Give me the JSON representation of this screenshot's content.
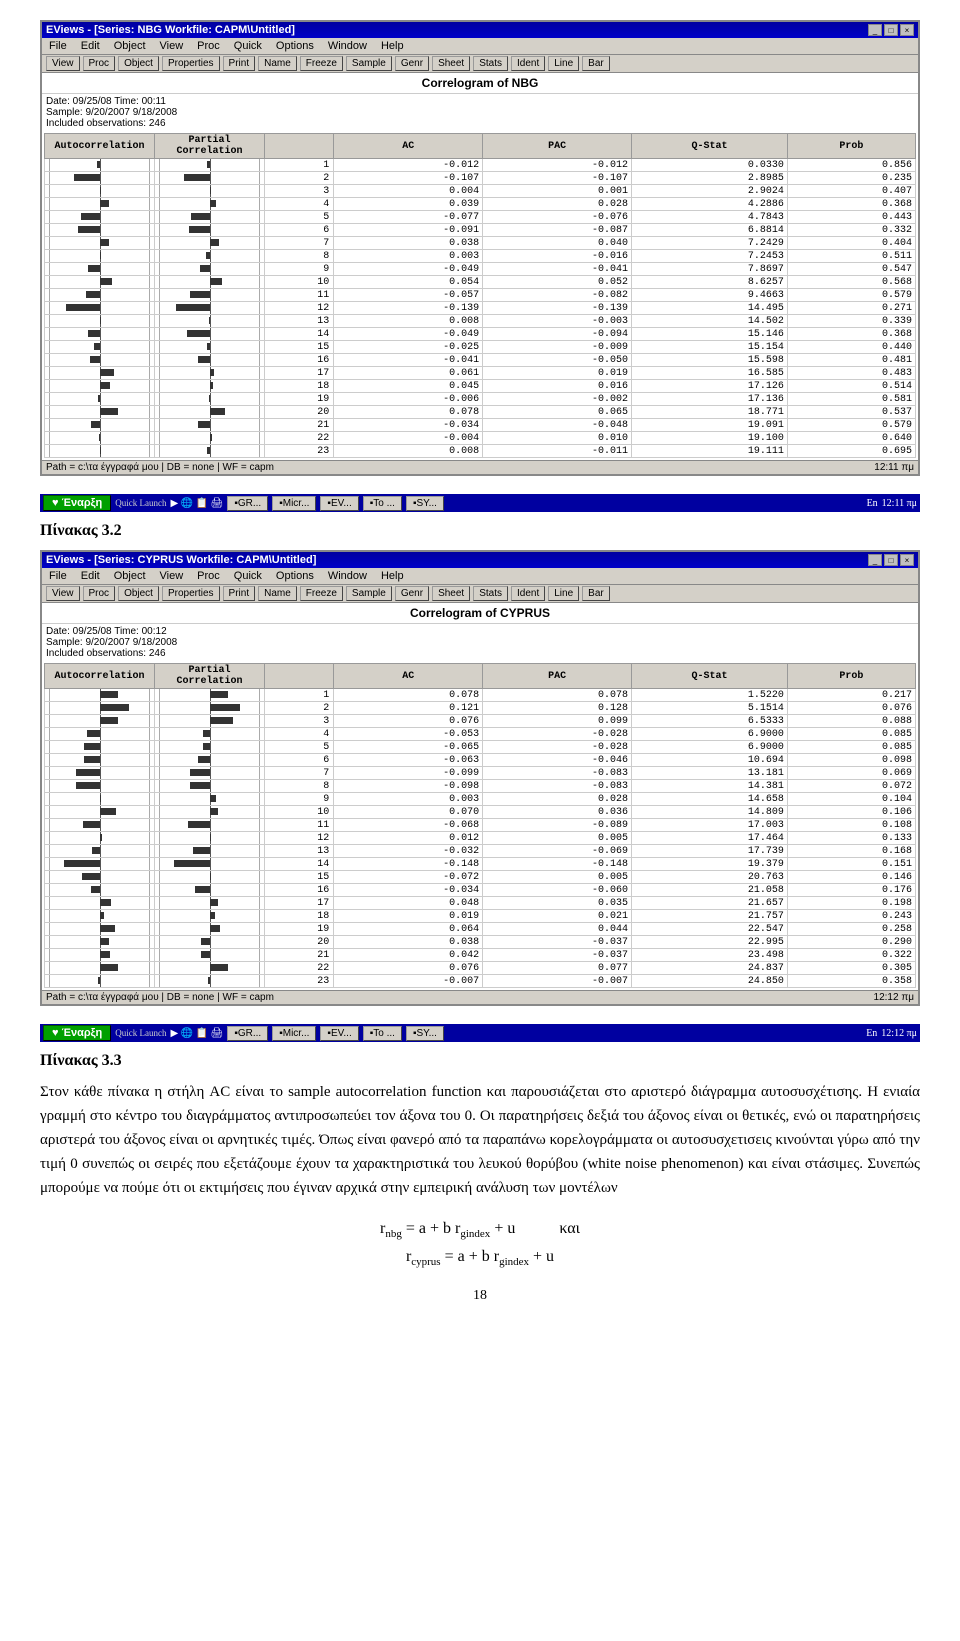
{
  "page": {
    "section1_label": "Πίνακας 3.2",
    "section2_label": "Πίνακας 3.3",
    "page_number": "18"
  },
  "window1": {
    "title": "EViews - [Series: NBG  Workfile: CAPM\\Untitled]",
    "menu_items": [
      "File",
      "Edit",
      "Object",
      "View",
      "Proc",
      "Quick",
      "Options",
      "Window",
      "Help"
    ],
    "toolbar_items": [
      "View",
      "Proc",
      "Object",
      "Properties",
      "Print",
      "Name",
      "Freeze",
      "Sample",
      "Genr",
      "Sheet",
      "Stats",
      "Ident",
      "Line",
      "Bar"
    ],
    "inner_title": "Correlogram of NBG",
    "info_line1": "Date: 09/25/08  Time: 00:11",
    "info_line2": "Sample: 9/20/2007 9/18/2008",
    "info_line3": "Included observations: 246",
    "columns": [
      "Autocorrelation",
      "Partial Correlation",
      "",
      "AC",
      "PAC",
      "Q-Stat",
      "Prob"
    ],
    "rows": [
      {
        "lag": "1",
        "ac": "-0.012",
        "pac": "-0.012",
        "qstat": "0.0330",
        "prob": "0.856"
      },
      {
        "lag": "2",
        "ac": "-0.107",
        "pac": "-0.107",
        "qstat": "2.8985",
        "prob": "0.235"
      },
      {
        "lag": "3",
        "ac": "0.004",
        "pac": "0.001",
        "qstat": "2.9024",
        "prob": "0.407"
      },
      {
        "lag": "4",
        "ac": "0.039",
        "pac": "0.028",
        "qstat": "4.2886",
        "prob": "0.368"
      },
      {
        "lag": "5",
        "ac": "-0.077",
        "pac": "-0.076",
        "qstat": "4.7843",
        "prob": "0.443"
      },
      {
        "lag": "6",
        "ac": "-0.091",
        "pac": "-0.087",
        "qstat": "6.8814",
        "prob": "0.332"
      },
      {
        "lag": "7",
        "ac": "0.038",
        "pac": "0.040",
        "qstat": "7.2429",
        "prob": "0.404"
      },
      {
        "lag": "8",
        "ac": "0.003",
        "pac": "-0.016",
        "qstat": "7.2453",
        "prob": "0.511"
      },
      {
        "lag": "9",
        "ac": "-0.049",
        "pac": "-0.041",
        "qstat": "7.8697",
        "prob": "0.547"
      },
      {
        "lag": "10",
        "ac": "0.054",
        "pac": "0.052",
        "qstat": "8.6257",
        "prob": "0.568"
      },
      {
        "lag": "11",
        "ac": "-0.057",
        "pac": "-0.082",
        "qstat": "9.4663",
        "prob": "0.579"
      },
      {
        "lag": "12",
        "ac": "-0.139",
        "pac": "-0.139",
        "qstat": "14.495",
        "prob": "0.271"
      },
      {
        "lag": "13",
        "ac": "0.008",
        "pac": "-0.003",
        "qstat": "14.502",
        "prob": "0.339"
      },
      {
        "lag": "14",
        "ac": "-0.049",
        "pac": "-0.094",
        "qstat": "15.146",
        "prob": "0.368"
      },
      {
        "lag": "15",
        "ac": "-0.025",
        "pac": "-0.009",
        "qstat": "15.154",
        "prob": "0.440"
      },
      {
        "lag": "16",
        "ac": "-0.041",
        "pac": "-0.050",
        "qstat": "15.598",
        "prob": "0.481"
      },
      {
        "lag": "17",
        "ac": "0.061",
        "pac": "0.019",
        "qstat": "16.585",
        "prob": "0.483"
      },
      {
        "lag": "18",
        "ac": "0.045",
        "pac": "0.016",
        "qstat": "17.126",
        "prob": "0.514"
      },
      {
        "lag": "19",
        "ac": "-0.006",
        "pac": "-0.002",
        "qstat": "17.136",
        "prob": "0.581"
      },
      {
        "lag": "20",
        "ac": "0.078",
        "pac": "0.065",
        "qstat": "18.771",
        "prob": "0.537"
      },
      {
        "lag": "21",
        "ac": "-0.034",
        "pac": "-0.048",
        "qstat": "19.091",
        "prob": "0.579"
      },
      {
        "lag": "22",
        "ac": "-0.004",
        "pac": "0.010",
        "qstat": "19.100",
        "prob": "0.640"
      },
      {
        "lag": "23",
        "ac": "0.008",
        "pac": "-0.011",
        "qstat": "19.111",
        "prob": "0.695"
      }
    ],
    "statusbar": "Path = c:\\τα έγγραφά μου | DB = none | WF = capm",
    "time": "12:11 πμ"
  },
  "window2": {
    "title": "EViews - [Series: CYPRUS  Workfile: CAPM\\Untitled]",
    "menu_items": [
      "File",
      "Edit",
      "Object",
      "View",
      "Proc",
      "Quick",
      "Options",
      "Window",
      "Help"
    ],
    "toolbar_items": [
      "View",
      "Proc",
      "Object",
      "Properties",
      "Print",
      "Name",
      "Freeze",
      "Sample",
      "Genr",
      "Sheet",
      "Stats",
      "Ident",
      "Line",
      "Bar"
    ],
    "inner_title": "Correlogram of CYPRUS",
    "info_line1": "Date: 09/25/08  Time: 00:12",
    "info_line2": "Sample: 9/20/2007 9/18/2008",
    "info_line3": "Included observations: 246",
    "columns": [
      "Autocorrelation",
      "Partial Correlation",
      "",
      "AC",
      "PAC",
      "Q-Stat",
      "Prob"
    ],
    "rows": [
      {
        "lag": "1",
        "ac": "0.078",
        "pac": "0.078",
        "qstat": "1.5220",
        "prob": "0.217"
      },
      {
        "lag": "2",
        "ac": "0.121",
        "pac": "0.128",
        "qstat": "5.1514",
        "prob": "0.076"
      },
      {
        "lag": "3",
        "ac": "0.076",
        "pac": "0.099",
        "qstat": "6.5333",
        "prob": "0.088"
      },
      {
        "lag": "4",
        "ac": "-0.053",
        "pac": "-0.028",
        "qstat": "6.9000",
        "prob": "0.085"
      },
      {
        "lag": "5",
        "ac": "-0.065",
        "pac": "-0.028",
        "qstat": "6.9000",
        "prob": "0.085"
      },
      {
        "lag": "6",
        "ac": "-0.063",
        "pac": "-0.046",
        "qstat": "10.694",
        "prob": "0.098"
      },
      {
        "lag": "7",
        "ac": "-0.099",
        "pac": "-0.083",
        "qstat": "13.181",
        "prob": "0.069"
      },
      {
        "lag": "8",
        "ac": "-0.098",
        "pac": "-0.083",
        "qstat": "14.381",
        "prob": "0.072"
      },
      {
        "lag": "9",
        "ac": "0.003",
        "pac": "0.028",
        "qstat": "14.658",
        "prob": "0.104"
      },
      {
        "lag": "10",
        "ac": "0.070",
        "pac": "0.036",
        "qstat": "14.809",
        "prob": "0.106"
      },
      {
        "lag": "11",
        "ac": "-0.068",
        "pac": "-0.089",
        "qstat": "17.003",
        "prob": "0.108"
      },
      {
        "lag": "12",
        "ac": "0.012",
        "pac": "0.005",
        "qstat": "17.464",
        "prob": "0.133"
      },
      {
        "lag": "13",
        "ac": "-0.032",
        "pac": "-0.069",
        "qstat": "17.739",
        "prob": "0.168"
      },
      {
        "lag": "14",
        "ac": "-0.148",
        "pac": "-0.148",
        "qstat": "19.379",
        "prob": "0.151"
      },
      {
        "lag": "15",
        "ac": "-0.072",
        "pac": "0.005",
        "qstat": "20.763",
        "prob": "0.146"
      },
      {
        "lag": "16",
        "ac": "-0.034",
        "pac": "-0.060",
        "qstat": "21.058",
        "prob": "0.176"
      },
      {
        "lag": "17",
        "ac": "0.048",
        "pac": "0.035",
        "qstat": "21.657",
        "prob": "0.198"
      },
      {
        "lag": "18",
        "ac": "0.019",
        "pac": "0.021",
        "qstat": "21.757",
        "prob": "0.243"
      },
      {
        "lag": "19",
        "ac": "0.064",
        "pac": "0.044",
        "qstat": "22.547",
        "prob": "0.258"
      },
      {
        "lag": "20",
        "ac": "0.038",
        "pac": "-0.037",
        "qstat": "22.995",
        "prob": "0.290"
      },
      {
        "lag": "21",
        "ac": "0.042",
        "pac": "-0.037",
        "qstat": "23.498",
        "prob": "0.322"
      },
      {
        "lag": "22",
        "ac": "0.076",
        "pac": "0.077",
        "qstat": "24.837",
        "prob": "0.305"
      },
      {
        "lag": "23",
        "ac": "-0.007",
        "pac": "-0.007",
        "qstat": "24.850",
        "prob": "0.358"
      }
    ],
    "statusbar": "Path = c:\\τα έγγραφά μου | DB = none | WF = capm",
    "time": "12:12 πμ"
  },
  "taskbar1": {
    "start_label": "Έναρξη",
    "quick_launch": "Quick Launch",
    "buttons": [
      "GR...",
      "Micr...",
      "EV...",
      "To ...",
      "SY..."
    ],
    "lang": "En",
    "time": "12:11 πμ"
  },
  "taskbar2": {
    "start_label": "Έναρξη",
    "quick_launch": "Quick Launch",
    "buttons": [
      "GR...",
      "Micr...",
      "EV...",
      "To ...",
      "SY..."
    ],
    "lang": "En",
    "time": "12:12 πμ"
  },
  "text": {
    "paragraph1": "Στον κάθε πίνακα η στήλη AC είναι το sample autocorrelation function και παρουσιάζεται στο αριστερό διάγραμμα αυτοσυσχέτισης. Η ενιαία γραμμή στο κέντρο του διαγράμματος αντιπροσωπεύει τον άξονα του 0. Οι παρατηρήσεις δεξιά του άξονος είναι οι θετικές, ενώ οι παρατηρήσεις αριστερά του άξονος είναι οι αρνητικές τιμές. Όπως είναι φανερό από τα παραπάνω κορελογράμματα οι αυτοσυσχετισεις κινούνται γύρω από την τιμή 0 συνεπώς οι σειρές που εξετάζουμε έχουν τα χαρακτηριστικά του λευκού θορύβου (white noise phenomenon) και είναι στάσιμες. Συνεπώς μπορούμε να πούμε ότι οι εκτιμήσεις που έγιναν αρχικά στην εμπειρική ανάλυση των μοντέλων",
    "formula1_lhs": "r",
    "formula1_sub_lhs": "nbg",
    "formula1_rhs": "= a + b r",
    "formula1_sub_rhs": "gindex",
    "formula1_end": " + u",
    "formula1_kai": "και",
    "formula2_lhs": "r",
    "formula2_sub_lhs": "cyprus",
    "formula2_rhs": "= a + b r",
    "formula2_sub_rhs": "gindex",
    "formula2_end": " + u"
  }
}
